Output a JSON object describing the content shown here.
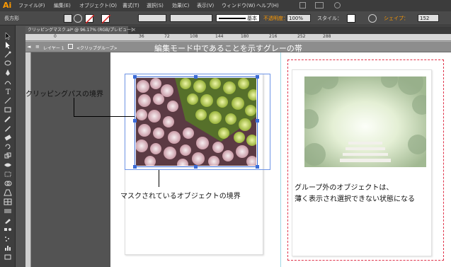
{
  "app": {
    "logo": "Ai"
  },
  "menu": [
    "ファイル(F)",
    "編集(E)",
    "オブジェクト(O)",
    "書式(T)",
    "選択(S)",
    "効果(C)",
    "表示(V)",
    "ウィンドウ(W)",
    "ヘルプ(H)"
  ],
  "control": {
    "object_type": "長方形",
    "stroke_style": "基本",
    "opacity_label": "不透明度：",
    "opacity_value": "100%",
    "style_label": "スタイル：",
    "shape_label": "シェイプ：",
    "shape_value": "152"
  },
  "document_tab": "クリッピングマスク.ai* @ 96.17% (RGB/プレビュー)",
  "ruler": [
    "0",
    "36",
    "72",
    "108",
    "144",
    "180",
    "216",
    "252",
    "288"
  ],
  "isolation": {
    "layer": "レイヤー 1",
    "group": "<クリップグループ>",
    "note": "編集モード中であることを示すグレーの帯"
  },
  "annotations": {
    "clipping_path": "クリッピングパスの境界",
    "masked_object": "マスクされているオブジェクトの境界",
    "outside_group_line1": "グループ外のオブジェクトは、",
    "outside_group_line2": "薄く表示され選択できない状態になる"
  },
  "colors": {
    "accent": "#ff9a00",
    "selection": "#3b6bd6",
    "isolation_band": "#8d8d8d",
    "outside_group_dash": "#e0344b"
  }
}
